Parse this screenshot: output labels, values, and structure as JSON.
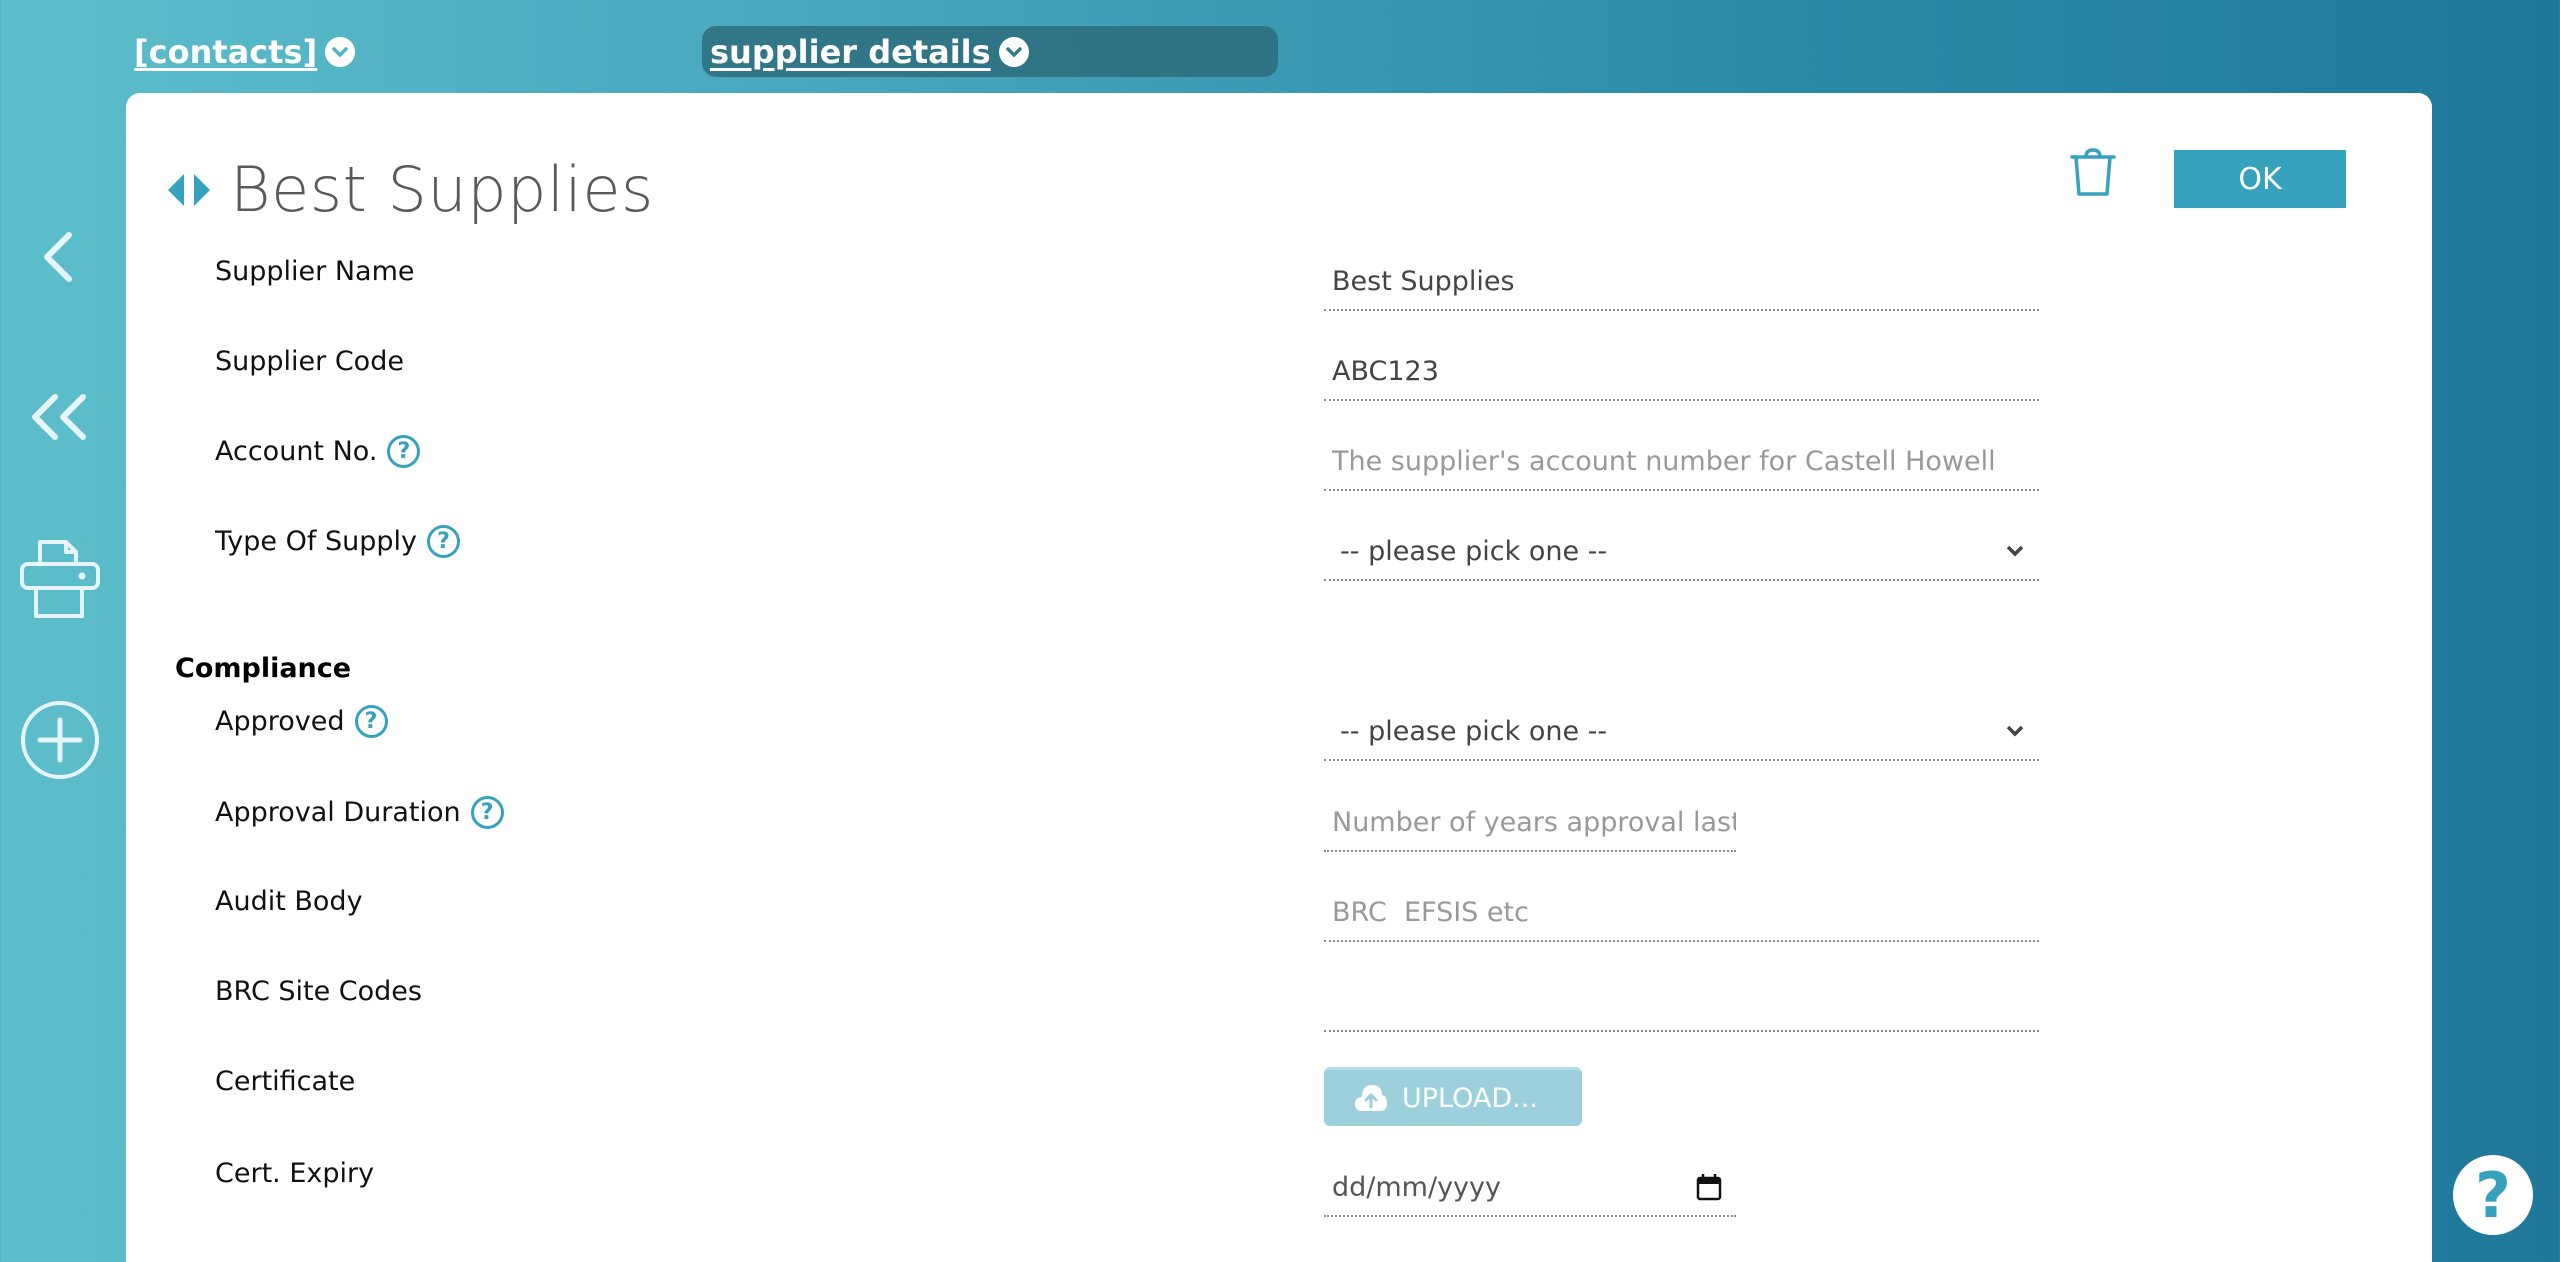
{
  "tabs": {
    "contacts": "[contacts]",
    "supplier_details": "supplier details"
  },
  "rail": {
    "back": "back-icon",
    "back_all": "double-chevron-icon",
    "print": "printer-icon",
    "add": "plus-circle-icon"
  },
  "header": {
    "title": "Best Supplies",
    "ok_label": "OK",
    "delete_icon": "trash-icon"
  },
  "colors": {
    "accent": "#37a2be",
    "upload_disabled": "#9dd0dd"
  },
  "form": {
    "supplier_name": {
      "label": "Supplier Name",
      "value": "Best Supplies"
    },
    "supplier_code": {
      "label": "Supplier Code",
      "value": "ABC123"
    },
    "account_no": {
      "label": "Account No.",
      "value": "",
      "placeholder": "The supplier's account number for Castell Howell"
    },
    "type_of_supply": {
      "label": "Type Of Supply",
      "selected": "-- please pick one --"
    },
    "compliance_heading": "Compliance",
    "approved": {
      "label": "Approved",
      "selected": "-- please pick one --"
    },
    "approval_duration": {
      "label": "Approval Duration",
      "value": "",
      "placeholder": "Number of years approval lasts"
    },
    "audit_body": {
      "label": "Audit Body",
      "value": "",
      "placeholder": "BRC  EFSIS etc"
    },
    "brc_site_codes": {
      "label": "BRC Site Codes",
      "value": ""
    },
    "certificate": {
      "label": "Certificate",
      "upload_label": "UPLOAD..."
    },
    "cert_expiry": {
      "label": "Cert. Expiry",
      "value": "dd/mm/yyyy"
    }
  },
  "help_fab": "?"
}
